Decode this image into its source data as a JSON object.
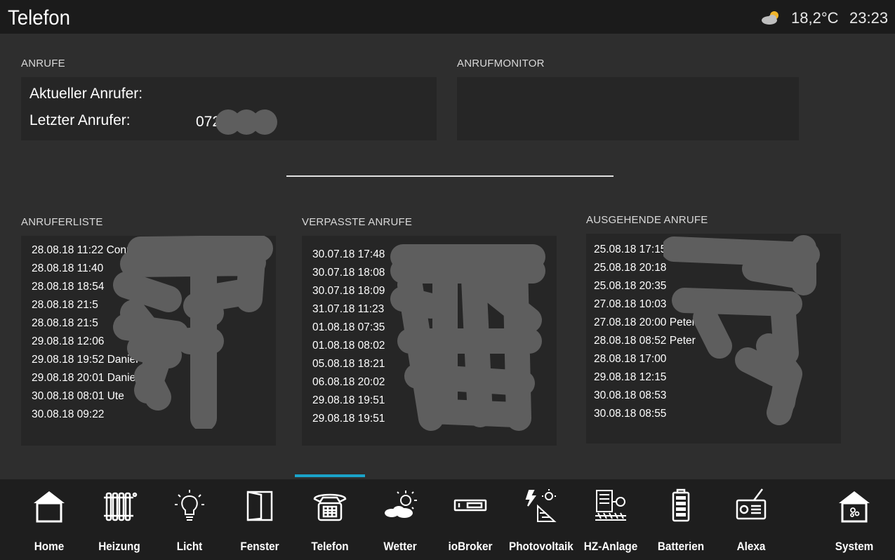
{
  "header": {
    "title": "Telefon",
    "weather_icon": "partly-cloudy-icon",
    "temperature": "18,2°C",
    "time": "23:23"
  },
  "anrufe": {
    "label": "ANRUFE",
    "current_caller_label": "Aktueller Anrufer:",
    "current_caller_value": "",
    "last_caller_label": "Letzter Anrufer:",
    "last_caller_value": "072"
  },
  "anrufmonitor": {
    "label": "ANRUFMONITOR"
  },
  "anruferliste": {
    "label": "ANRUFERLISTE",
    "rows": [
      "28.08.18 11:22 Conni",
      "28.08.18 11:40",
      "28.08.18 18:54",
      "28.08.18 21:5",
      "28.08.18 21:5",
      "29.08.18 12:06",
      "29.08.18 19:52 Daniel",
      "29.08.18 20:01 Danie",
      "30.08.18 08:01 Ute",
      "30.08.18 09:22"
    ]
  },
  "verpasste": {
    "label": "VERPASSTE ANRUFE",
    "rows": [
      "30.07.18 17:48",
      "30.07.18 18:08",
      "30.07.18 18:09",
      "31.07.18 11:23",
      "01.08.18 07:35",
      "01.08.18 08:02",
      "05.08.18 18:21",
      "06.08.18 20:02",
      "29.08.18 19:51",
      "29.08.18 19:51"
    ]
  },
  "ausgehende": {
    "label": "AUSGEHENDE ANRUFE",
    "rows": [
      "25.08.18 17:15",
      "25.08.18 20:18",
      "25.08.18 20:35",
      "27.08.18 10:03",
      "27.08.18 20:00 Peter",
      "28.08.18 08:52 Peter",
      "28.08.18 17:00",
      "29.08.18 12:15",
      "30.08.18 08:53",
      "30.08.18 08:55"
    ]
  },
  "nav": {
    "items": [
      {
        "label": "Home",
        "icon": "house-icon"
      },
      {
        "label": "Heizung",
        "icon": "radiator-icon"
      },
      {
        "label": "Licht",
        "icon": "light-bulb-icon"
      },
      {
        "label": "Fenster",
        "icon": "window-icon"
      },
      {
        "label": "Telefon",
        "icon": "telephone-icon"
      },
      {
        "label": "Wetter",
        "icon": "weather-icon"
      },
      {
        "label": "ioBroker",
        "icon": "server-icon"
      },
      {
        "label": "Photovoltaik",
        "icon": "solar-panel-icon"
      },
      {
        "label": "HZ-Anlage",
        "icon": "heating-system-icon"
      },
      {
        "label": "Batterien",
        "icon": "battery-icon"
      },
      {
        "label": "Alexa",
        "icon": "radio-icon"
      },
      {
        "label": "System",
        "icon": "system-icon"
      }
    ],
    "active": "Telefon",
    "accent_color": "#1aa3c9"
  }
}
